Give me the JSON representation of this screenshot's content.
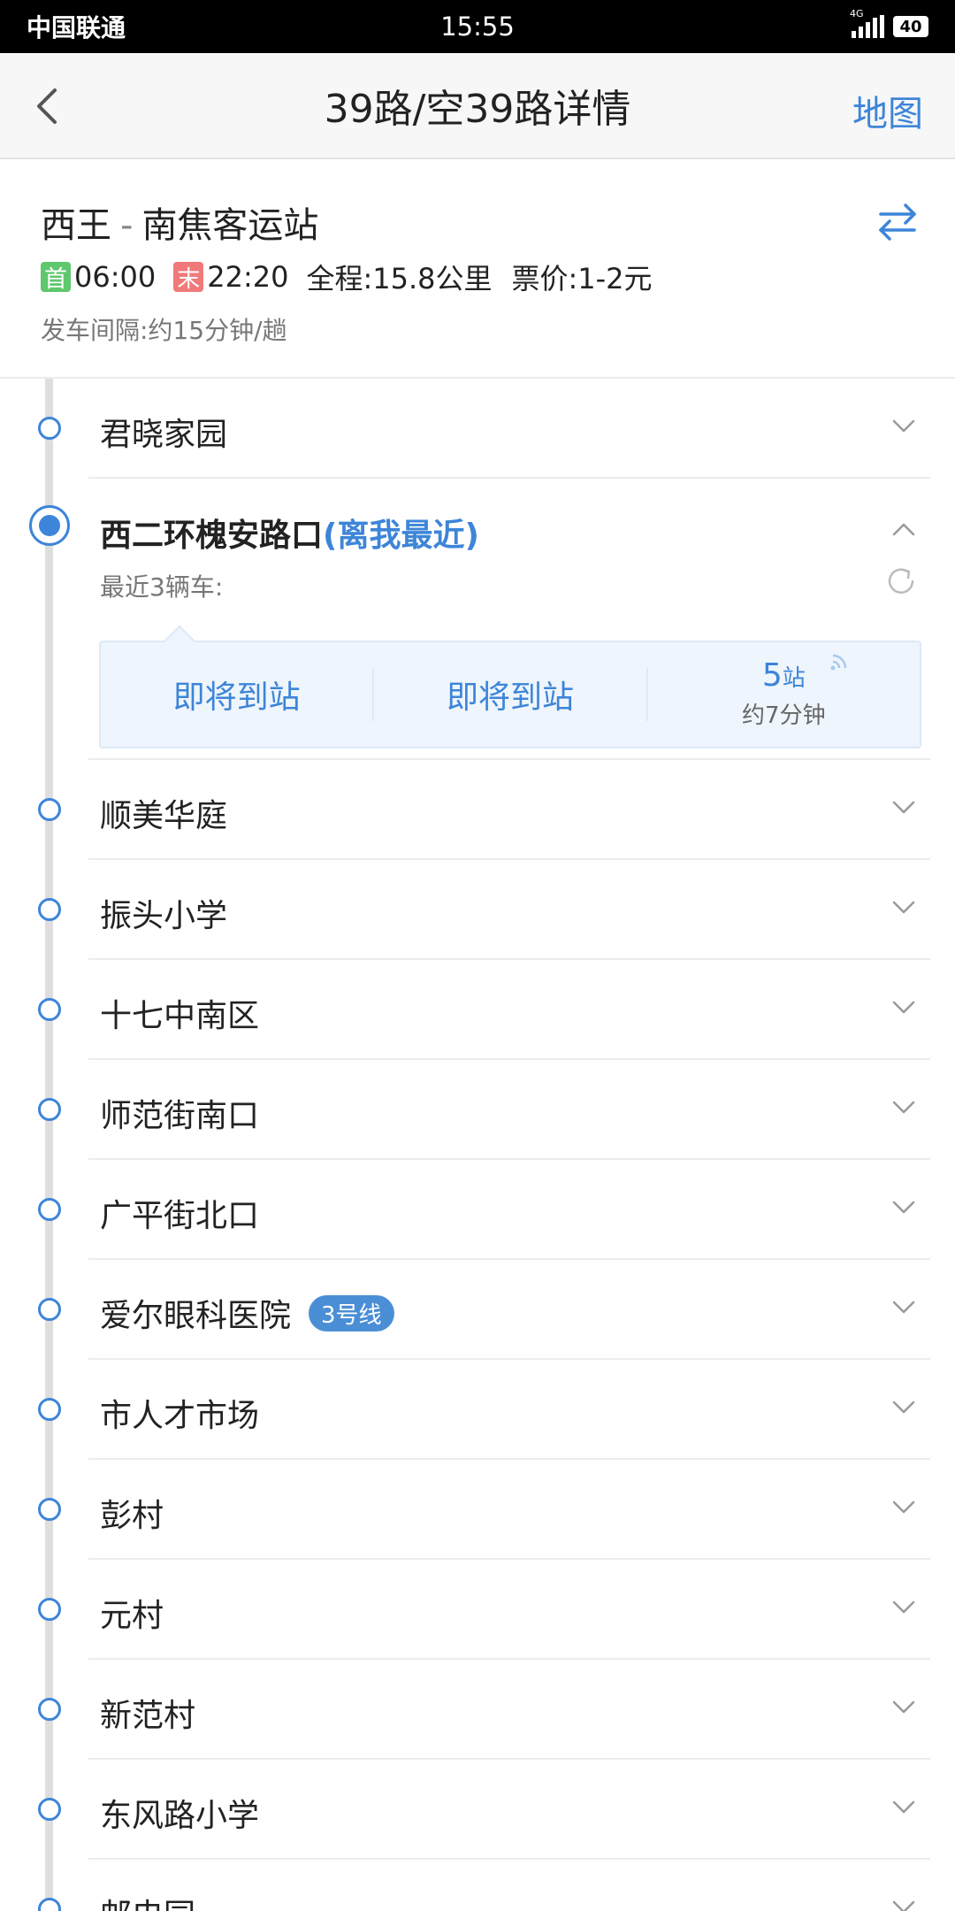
{
  "status_bar": {
    "carrier": "中国联通",
    "time": "15:55",
    "network": "4G",
    "battery": "40"
  },
  "nav": {
    "title": "39路/空39路详情",
    "map_label": "地图"
  },
  "route": {
    "origin": "西王",
    "separator": "-",
    "destination": "南焦客运站",
    "first_badge": "首",
    "first_time": "06:00",
    "last_badge": "末",
    "last_time": "22:20",
    "distance": "全程:15.8公里",
    "fare": "票价:1-2元",
    "interval": "发车间隔:约15分钟/趟"
  },
  "nearest_stop": {
    "name": "西二环槐安路口",
    "tag": "(离我最近)",
    "recent_label": "最近3辆车:",
    "arrivals": [
      {
        "text": "即将到站"
      },
      {
        "text": "即将到站"
      },
      {
        "stops": "5",
        "unit": "站",
        "eta": "约7分钟"
      }
    ]
  },
  "stops": [
    {
      "name": "君晓家园"
    },
    {
      "name": "顺美华庭"
    },
    {
      "name": "振头小学"
    },
    {
      "name": "十七中南区"
    },
    {
      "name": "师范街南口"
    },
    {
      "name": "广平街北口"
    },
    {
      "name": "爱尔眼科医院",
      "badge": "3号线"
    },
    {
      "name": "市人才市场"
    },
    {
      "name": "彭村"
    },
    {
      "name": "元村"
    },
    {
      "name": "新范村"
    },
    {
      "name": "东风路小学"
    },
    {
      "name": "邮电园"
    }
  ],
  "colors": {
    "accent": "#3d85d8",
    "first_badge": "#5fc76d",
    "last_badge": "#f07a7a",
    "line_badge": "#4a8fd6"
  }
}
